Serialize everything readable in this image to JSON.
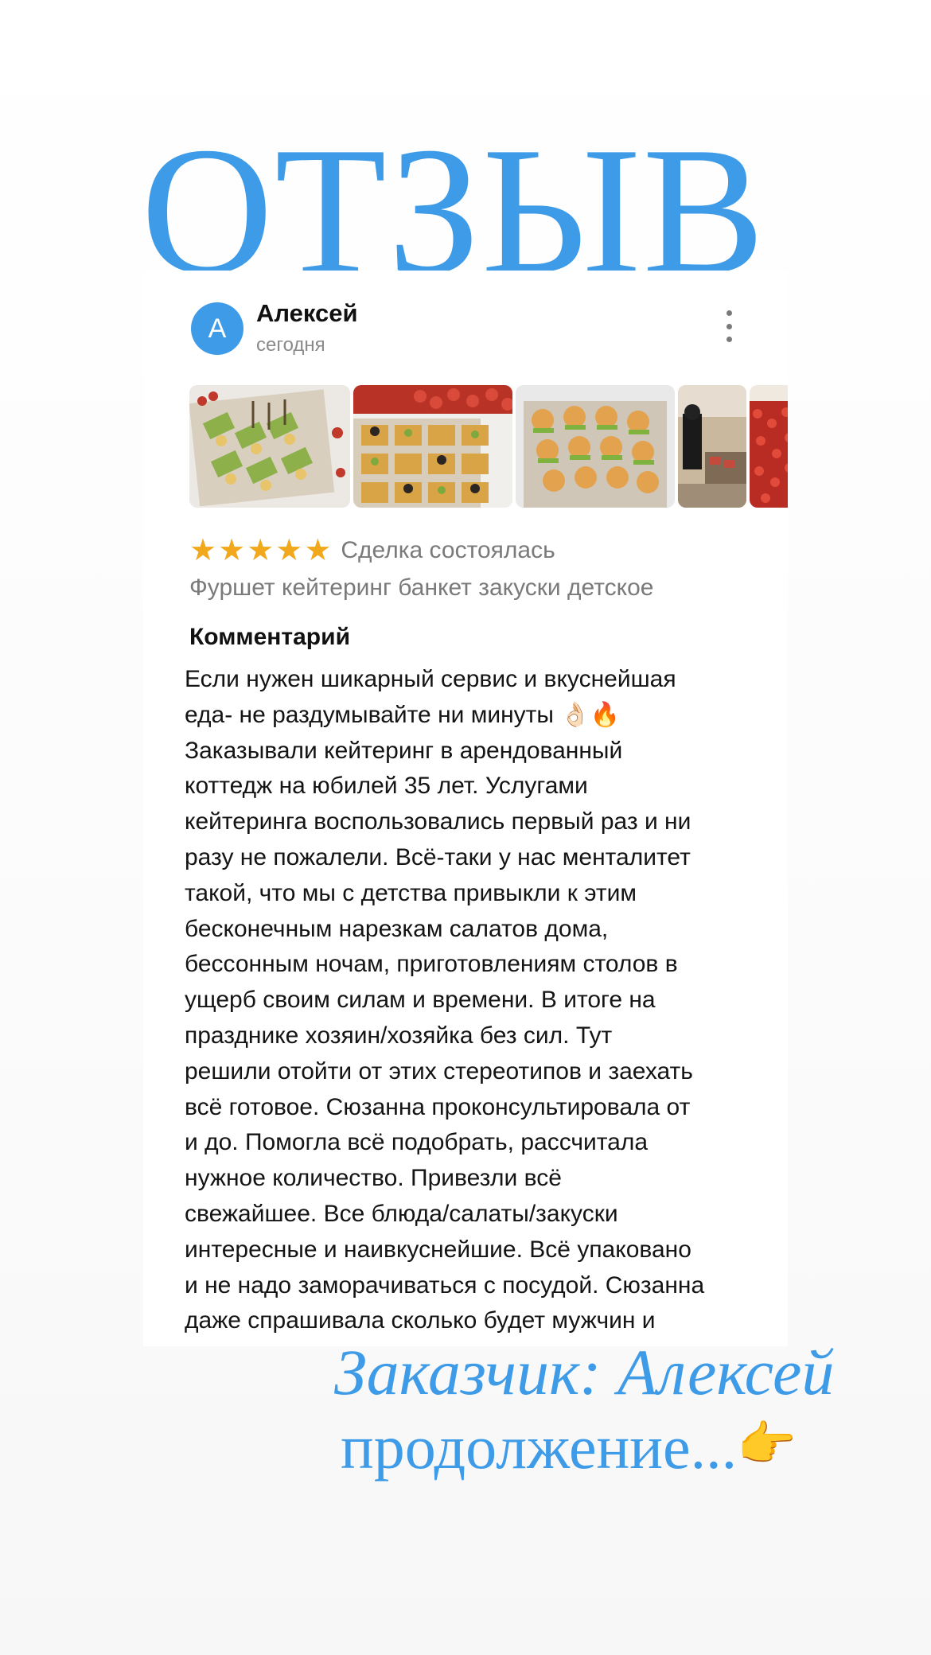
{
  "headline": "ОТЗЫВ",
  "review": {
    "avatar_letter": "А",
    "author": "Алексей",
    "date": "сегодня",
    "menu_icon": "more-vertical-icon",
    "photos": [
      "canapes-platter-photo",
      "tartlets-platter-photo",
      "mini-burgers-photo",
      "venue-photo",
      "berries-tray-photo"
    ],
    "rating": 5,
    "star_glyph": "★",
    "deal_status": "Сделка состоялась",
    "tags": "Фуршет кейтеринг банкет закуски детское",
    "comment_title": "Комментарий",
    "comment_text": "Если нужен шикарный сервис и вкуснейшая\nеда- не раздумывайте ни  минуты 👌🏻🔥\nЗаказывали кейтеринг в арендованный\nкоттедж на юбилей 35 лет. Услугами\nкейтеринга воспользовались первый раз и ни\nразу не пожалели. Всё-таки у нас менталитет\nтакой, что мы с детства привыкли к этим\nбесконечным нарезкам салатов дома,\nбессонным ночам, приготовлениям столов в\nущерб своим силам и времени. В итоге на\nпразднике хозяин/хозяйка без сил. Тут\nрешили отойти от этих стереотипов и заехать\nвсё готовое. Сюзанна проконсультировала от\nи до. Помогла всё подобрать, рассчитала\nнужное количество. Привезли всё\nсвежайшее. Все блюда/салаты/закуски\nинтересные и наивкуснейшие. Всё упаковано\nи не надо заморачиваться с посудой. Сюзанна\nдаже спрашивала сколько будет мужчин и"
  },
  "caption": {
    "customer": "Заказчик: Алексей",
    "continuation": "продолжение...",
    "pointing_emoji": "👉"
  },
  "colors": {
    "accent_blue": "#3e9be8",
    "star_orange": "#f2a81d",
    "muted_gray": "#7a7a7a"
  }
}
